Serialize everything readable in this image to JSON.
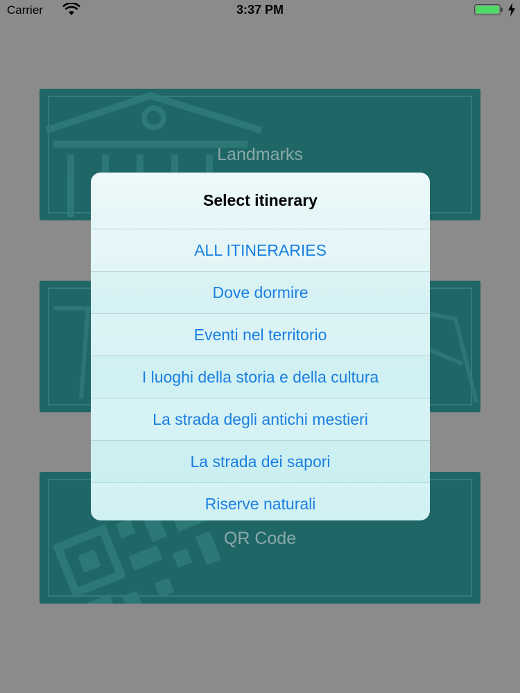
{
  "status_bar": {
    "carrier": "Carrier",
    "time": "3:37 PM",
    "icons": [
      "wifi-icon",
      "battery-icon",
      "charging-icon"
    ]
  },
  "tiles": [
    {
      "label": "Landmarks",
      "icon": "building-icon"
    },
    {
      "label": "",
      "icon": "map-icon"
    },
    {
      "label": "QR Code",
      "icon": "qr-code-icon"
    }
  ],
  "dialog": {
    "title": "Select itinerary",
    "options": [
      "ALL ITINERARIES",
      "Dove dormire",
      "Eventi nel territorio",
      "I luoghi della storia e della cultura",
      "La strada degli antichi mestieri",
      "La strada dei sapori",
      "Riserve naturali"
    ]
  },
  "colors": {
    "backdrop": "#8b8b8b",
    "tile": "#1f6766",
    "option_text": "#1a7fe0",
    "battery": "#4cd964"
  }
}
